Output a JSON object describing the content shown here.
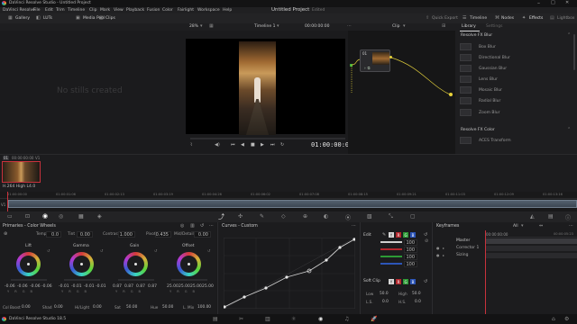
{
  "window": {
    "title": "DaVinci Resolve Studio - Untitled Project"
  },
  "menu": {
    "app_name": "DaVinci Resolve",
    "items": [
      "File",
      "Edit",
      "Trim",
      "Timeline",
      "Clip",
      "Mark",
      "View",
      "Playback",
      "Fusion",
      "Color",
      "Fairlight",
      "Workspace",
      "Help"
    ]
  },
  "project": {
    "title": "Untitled Project",
    "status": "Edited"
  },
  "top_right": {
    "quick_export": "Quick Export",
    "timeline": "Timeline",
    "nodes": "Nodes",
    "effects": "Effects",
    "lightbox": "Lightbox"
  },
  "toolbar": {
    "gallery": "Gallery",
    "luts": "LUTs",
    "media_pool": "Media Pool",
    "clips": "Clips"
  },
  "viewer": {
    "zoom": "28%",
    "timeline_name": "Timeline 1",
    "timecode_top": "00:00:00:00",
    "clip_label": "Clip",
    "timecode": "01:00:00:00"
  },
  "gallery": {
    "empty_text": "No stills created"
  },
  "node": {
    "label": "01"
  },
  "library": {
    "tab_library": "Library",
    "tab_settings": "Settings",
    "section_blur": "Resolve FX Blur",
    "blur_items": [
      "Box Blur",
      "Directional Blur",
      "Gaussian Blur",
      "Lens Blur",
      "Mosaic Blur",
      "Radial Blur",
      "Zoom Blur"
    ],
    "section_color": "Resolve FX Color",
    "color_items": [
      "ACES Transform"
    ]
  },
  "clips": {
    "clip_number": "01",
    "clip_timecode": "00:00:00:00",
    "clip_track": "V1",
    "codec": "H.264 High L4.0"
  },
  "ruler": {
    "ticks": [
      "01:00:00:00",
      "01:00:01:06",
      "01:00:02:13",
      "01:00:03:19",
      "01:00:04:26",
      "01:00:06:02",
      "01:00:07:08",
      "01:00:08:15",
      "01:00:09:21",
      "01:00:11:03",
      "01:00:12:09",
      "01:00:13:16"
    ]
  },
  "primaries": {
    "title": "Primaries - Color Wheels",
    "params": {
      "temp_label": "Temp",
      "temp": "0.0",
      "tint_label": "Tint",
      "tint": "0.00",
      "contrast_label": "Contrast",
      "contrast": "1.000",
      "pivot_label": "Pivot",
      "pivot": "0.435",
      "middetail_label": "Mid/Detail",
      "middetail": "0.00"
    },
    "wheels": [
      {
        "name": "Lift",
        "values": [
          "-0.06",
          "-0.06",
          "-0.06",
          "-0.06"
        ]
      },
      {
        "name": "Gamma",
        "values": [
          "-0.01",
          "-0.01",
          "-0.01",
          "-0.01"
        ]
      },
      {
        "name": "Gain",
        "values": [
          "0.87",
          "0.87",
          "0.87",
          "0.87"
        ]
      },
      {
        "name": "Offset",
        "values": [
          "25.00",
          "25.00",
          "25.00",
          "25.00"
        ]
      }
    ],
    "bottom": {
      "colboost_label": "Col Boost",
      "colboost": "0.00",
      "shad_label": "Shad",
      "shad": "0.00",
      "hilight_label": "Hi/Light",
      "hilight": "0.00",
      "sat_label": "Sat",
      "sat": "50.00",
      "hue_label": "Hue",
      "hue": "50.00",
      "lmix_label": "L. Mix",
      "lmix": "100.00"
    }
  },
  "curves": {
    "title": "Curves - Custom"
  },
  "edit_panel": {
    "title": "Edit",
    "rows": [
      "100",
      "100",
      "100",
      "100"
    ],
    "softclip_title": "Soft Clip",
    "low_label": "Low",
    "low": "50.0",
    "high_label": "High",
    "high": "50.0",
    "ls_label": "L.S.",
    "ls": "0.0",
    "hs_label": "H.S.",
    "hs": "0.0"
  },
  "keyframes": {
    "title": "Keyframes",
    "filter": "All",
    "timecode": "00:00:00:00",
    "end_timecode": "00:00:05:23",
    "tracks": [
      "Master",
      "Corrector 1",
      "Sizing"
    ]
  },
  "bottombar": {
    "app_label": "DaVinci Resolve Studio 18.5"
  },
  "colors": {
    "accent_red": "#c8323c",
    "node_yellow": "#e8d23a",
    "wheel_bg": "#1c1c1e"
  }
}
